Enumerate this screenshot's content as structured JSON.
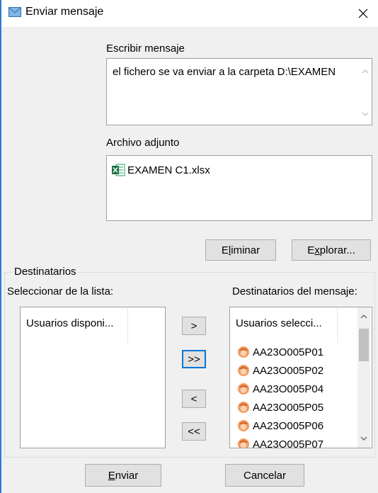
{
  "window": {
    "title": "Enviar mensaje",
    "icon": "envelope-icon",
    "close_icon": "close-icon"
  },
  "message": {
    "label": "Escribir mensaje",
    "value": "el fichero se va enviar a la carpeta D:\\EXAMEN"
  },
  "attachment": {
    "label": "Archivo adjunto",
    "file_name": "EXAMEN C1.xlsx",
    "file_icon": "excel-file-icon"
  },
  "attachment_buttons": {
    "remove_label": "Eliminar",
    "browse_label": "Explorar..."
  },
  "recipients": {
    "group_label": "Destinatarios",
    "available_label": "Seleccionar de la lista:",
    "available_column": "Usuarios disponi...",
    "selected_label": "Destinatarios del mensaje:",
    "selected_column": "Usuarios selecci...",
    "selected_users": [
      "AA23O005P01",
      "AA23O005P02",
      "AA23O005P04",
      "AA23O005P05",
      "AA23O005P06",
      "AA23O005P07"
    ],
    "add_one": ">",
    "add_all": ">>",
    "remove_one": "<",
    "remove_all": "<<"
  },
  "footer": {
    "send_label": "Enviar",
    "cancel_label": "Cancelar"
  },
  "colors": {
    "window_border": "#2b7cd3",
    "focus": "#0078d7",
    "background": "#f0f0f0"
  }
}
